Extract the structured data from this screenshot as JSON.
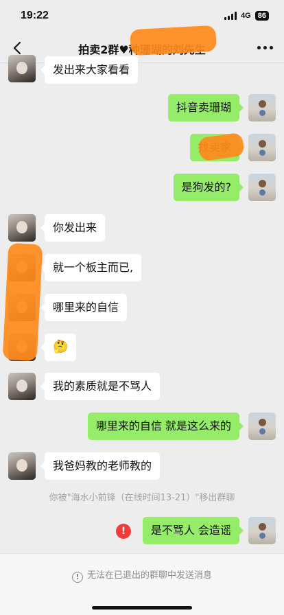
{
  "status_bar": {
    "time": "19:22",
    "network": "4G",
    "battery": "86"
  },
  "nav": {
    "title": "拍卖2群♥种珊瑚的刘先生"
  },
  "messages": [
    {
      "side": "left",
      "text": "发出来大家看看"
    },
    {
      "side": "right",
      "text": "抖音卖珊瑚"
    },
    {
      "side": "right",
      "text": "找卖家"
    },
    {
      "side": "right",
      "text": "是狗发的?"
    },
    {
      "side": "left",
      "text": "你发出来"
    },
    {
      "side": "left",
      "text": "就一个板主而已,"
    },
    {
      "side": "left",
      "text": "哪里来的自信"
    },
    {
      "side": "left",
      "text": "🤔"
    },
    {
      "side": "left",
      "text": "我的素质就是不骂人"
    },
    {
      "side": "right",
      "text": "哪里来的自信 就是这么来的"
    },
    {
      "side": "left",
      "text": "我爸妈教的老师教的"
    },
    {
      "side": "right",
      "text": "是不骂人 会造谣"
    }
  ],
  "system_note": "你被\"海水小前锋（在线时间13-21）\"移出群聊",
  "error_icon_label": "!",
  "bottom": {
    "info_icon": "!",
    "notice": "无法在已退出的群聊中发送消息"
  },
  "colors": {
    "self_bubble": "#95ec69",
    "other_bubble": "#ffffff",
    "background": "#ededed",
    "redaction": "#ff8a1c",
    "error": "#f23c3c"
  },
  "icons": {
    "back": "chevron-left-icon",
    "more": "more-dots-icon",
    "error": "error-icon",
    "info": "info-circle-icon"
  }
}
